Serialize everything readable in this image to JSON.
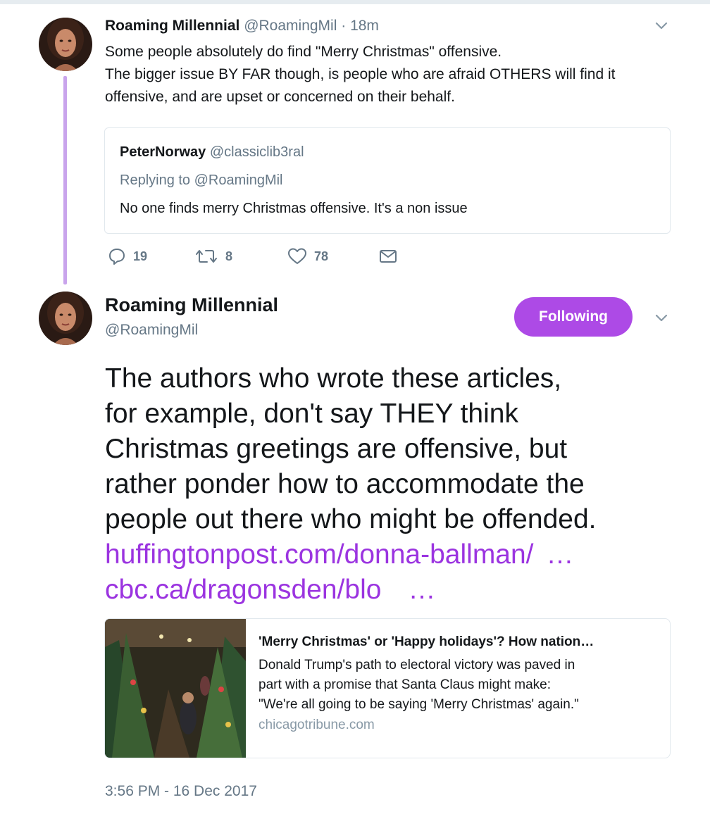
{
  "colors": {
    "accent": "#ad4ae6",
    "link": "#9b34e0",
    "thread_line": "#c9a4ec",
    "secondary_text": "#657786"
  },
  "tweet1": {
    "name": "Roaming Millennial",
    "handle": "@RoamingMil",
    "separator": "·",
    "time": "18m",
    "text_lines": [
      "Some people absolutely do find \"Merry Christmas\" offensive.",
      "The bigger issue BY FAR though, is people who are afraid OTHERS will find it",
      "offensive, and are upset or concerned on their behalf."
    ],
    "quoted": {
      "name": "PeterNorway",
      "handle": "@classiclib3ral",
      "replying_to": "Replying to @RoamingMil",
      "text": "No one finds merry Christmas offensive. It's a non issue"
    },
    "actions": {
      "reply_icon": "reply-icon",
      "replies": "19",
      "retweet_icon": "retweet-icon",
      "retweets": "8",
      "like_icon": "heart-icon",
      "likes": "78",
      "dm_icon": "envelope-icon"
    }
  },
  "tweet2": {
    "name": "Roaming Millennial",
    "handle": "@RoamingMil",
    "follow_label": "Following",
    "text_lines": [
      "The authors who wrote these articles,",
      "for example, don't say THEY think",
      "Christmas greetings are offensive, but",
      "rather ponder how to accommodate the",
      "people out there who might be offended."
    ],
    "links": [
      {
        "text": "huffingtonpost.com/donna-ballman/",
        "ellipsis": "…"
      },
      {
        "text": "cbc.ca/dragonsden/blo",
        "ellipsis": "…"
      }
    ],
    "card": {
      "title": "'Merry Christmas' or 'Happy holidays'? How nation…",
      "desc_lines": [
        "Donald Trump's path to electoral victory was paved in",
        "part with a promise that Santa Claus might make:",
        "\"We're all going to be saying 'Merry Christmas' again.\""
      ],
      "domain": "chicagotribune.com"
    },
    "timestamp": "3:56 PM - 16 Dec 2017"
  }
}
